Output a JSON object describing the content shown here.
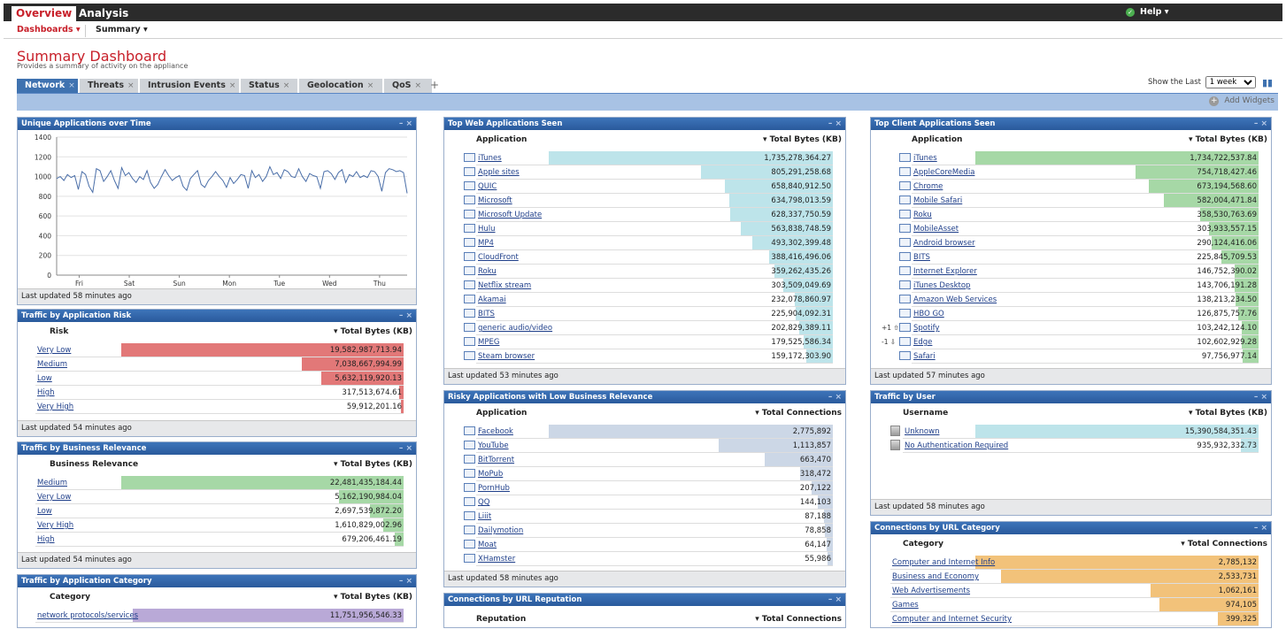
{
  "nav": {
    "overview": "Overview",
    "analysis": "Analysis",
    "help": "Help ▾",
    "help_icon": "check-circle-icon"
  },
  "subnav": {
    "dashboards": "Dashboards ▾",
    "summary": "Summary ▾"
  },
  "page": {
    "title": "Summary Dashboard",
    "subtitle": "Provides a summary of activity on the appliance"
  },
  "tabs": [
    "Network",
    "Threats",
    "Intrusion Events",
    "Status",
    "Geolocation",
    "QoS"
  ],
  "tab_add": "+",
  "tab_close": "×",
  "controls": {
    "show_last_label": "Show the Last",
    "show_last_value": "1 week",
    "pause_icon": "pause-icon"
  },
  "add_widgets": "Add Widgets",
  "colors": {
    "header_blue": "#3d74b9",
    "red": "#e27878",
    "green": "#a6d8a6",
    "cyan": "#bde4ea",
    "slate": "#ccd7e6",
    "purple": "#b9a9d7",
    "orange": "#f2c27a"
  },
  "w_unique": {
    "title": "Unique Applications over Time",
    "footer": "Last updated 58 minutes ago",
    "chart_data": {
      "type": "line",
      "title": "",
      "xlabel": "",
      "ylabel": "",
      "x_ticks": [
        "Fri",
        "Sat",
        "Sun",
        "Mon",
        "Tue",
        "Wed",
        "Thu"
      ],
      "y_ticks": [
        0,
        200,
        400,
        600,
        800,
        1000,
        1200,
        1400
      ],
      "ylim": [
        0,
        1400
      ],
      "grid": true,
      "series": [
        {
          "values": [
            980,
            1000,
            960,
            1020,
            990,
            1010,
            870,
            1050,
            1020,
            900,
            840,
            1080,
            1060,
            950,
            1000,
            1060,
            960,
            880,
            1090,
            1010,
            1040,
            980,
            940,
            1000,
            970,
            1060,
            940,
            880,
            920,
            1000,
            1070,
            1010,
            960,
            990,
            1010,
            900,
            860,
            980,
            1020,
            1060,
            920,
            890,
            960,
            1000,
            1050,
            1000,
            960,
            890,
            990,
            930,
            970,
            1020,
            1010,
            880,
            1060,
            990,
            1020,
            950,
            1000,
            1100,
            1020,
            1040,
            980,
            1070,
            1050,
            1000,
            990,
            1080,
            1000,
            950,
            1030,
            1010,
            1000,
            880,
            1050,
            1060,
            1030,
            970,
            1040,
            1070,
            940,
            1020,
            1000,
            1050,
            990,
            1010,
            990,
            1060,
            1050,
            1000,
            850,
            1040,
            1080,
            1070,
            1050,
            1060,
            1040,
            830
          ]
        }
      ]
    }
  },
  "w_risk": {
    "title": "Traffic by Application Risk",
    "col1": "Risk",
    "col2": "▾ Total Bytes (KB)",
    "rows": [
      {
        "name": "Very Low",
        "value": "19,582,987,713.94",
        "frac": 1.0
      },
      {
        "name": "Medium",
        "value": "7,038,667,994.99",
        "frac": 0.36
      },
      {
        "name": "Low",
        "value": "5,632,119,920.13",
        "frac": 0.29
      },
      {
        "name": "High",
        "value": "317,513,674.61",
        "frac": 0.016
      },
      {
        "name": "Very High",
        "value": "59,912,201.16",
        "frac": 0.003
      }
    ],
    "footer": "Last updated 54 minutes ago"
  },
  "w_business": {
    "title": "Traffic by Business Relevance",
    "col1": "Business Relevance",
    "col2": "▾ Total Bytes (KB)",
    "rows": [
      {
        "name": "Medium",
        "value": "22,481,435,184.44",
        "frac": 1.0
      },
      {
        "name": "Very Low",
        "value": "5,162,190,984.04",
        "frac": 0.23
      },
      {
        "name": "Low",
        "value": "2,697,539,872.20",
        "frac": 0.12
      },
      {
        "name": "Very High",
        "value": "1,610,829,002.96",
        "frac": 0.072
      },
      {
        "name": "High",
        "value": "679,206,461.19",
        "frac": 0.03
      }
    ],
    "footer": "Last updated 54 minutes ago"
  },
  "w_category": {
    "title": "Traffic by Application Category",
    "col1": "Category",
    "col2": "▾ Total Bytes (KB)",
    "rows": [
      {
        "name": "network protocols/services",
        "value": "11,751,956,546.33",
        "frac": 1.0
      }
    ]
  },
  "w_web": {
    "title": "Top Web Applications Seen",
    "col1": "Application",
    "col2": "▾ Total Bytes (KB)",
    "rows": [
      {
        "name": "iTunes",
        "value": "1,735,278,364.27",
        "frac": 1.0
      },
      {
        "name": "Apple sites",
        "value": "805,291,258.68",
        "frac": 0.464
      },
      {
        "name": "QUIC",
        "value": "658,840,912.50",
        "frac": 0.38
      },
      {
        "name": "Microsoft",
        "value": "634,798,013.59",
        "frac": 0.366
      },
      {
        "name": "Microsoft Update",
        "value": "628,337,750.59",
        "frac": 0.362
      },
      {
        "name": "Hulu",
        "value": "563,838,748.59",
        "frac": 0.325
      },
      {
        "name": "MP4",
        "value": "493,302,399.48",
        "frac": 0.284
      },
      {
        "name": "CloudFront",
        "value": "388,416,496.06",
        "frac": 0.224
      },
      {
        "name": "Roku",
        "value": "359,262,435.26",
        "frac": 0.207
      },
      {
        "name": "Netflix stream",
        "value": "303,509,049.69",
        "frac": 0.175
      },
      {
        "name": "Akamai",
        "value": "232,078,860.97",
        "frac": 0.134
      },
      {
        "name": "BITS",
        "value": "225,904,092.31",
        "frac": 0.13
      },
      {
        "name": "generic audio/video",
        "value": "202,829,389.11",
        "frac": 0.117
      },
      {
        "name": "MPEG",
        "value": "179,525,586.34",
        "frac": 0.103
      },
      {
        "name": "Steam browser",
        "value": "159,172,303.90",
        "frac": 0.092
      }
    ],
    "footer": "Last updated 53 minutes ago"
  },
  "w_risky": {
    "title": "Risky Applications with Low Business Relevance",
    "col1": "Application",
    "col2": "▾ Total Connections",
    "rows": [
      {
        "name": "Facebook",
        "value": "2,775,892",
        "frac": 1.0
      },
      {
        "name": "YouTube",
        "value": "1,113,857",
        "frac": 0.401
      },
      {
        "name": "BitTorrent",
        "value": "663,470",
        "frac": 0.239
      },
      {
        "name": "MoPub",
        "value": "318,472",
        "frac": 0.115
      },
      {
        "name": "PornHub",
        "value": "207,122",
        "frac": 0.075
      },
      {
        "name": "QQ",
        "value": "144,103",
        "frac": 0.052
      },
      {
        "name": "Liiit",
        "value": "87,188",
        "frac": 0.031
      },
      {
        "name": "Dailymotion",
        "value": "78,858",
        "frac": 0.028
      },
      {
        "name": "Moat",
        "value": "64,147",
        "frac": 0.023
      },
      {
        "name": "XHamster",
        "value": "55,986",
        "frac": 0.02
      }
    ],
    "footer": "Last updated 58 minutes ago"
  },
  "w_reputation": {
    "title": "Connections by URL Reputation",
    "col1": "Reputation",
    "col2": "▾ Total Connections"
  },
  "w_client": {
    "title": "Top Client Applications Seen",
    "col1": "Application",
    "col2": "▾ Total Bytes (KB)",
    "rows": [
      {
        "name": "iTunes",
        "value": "1,734,722,537.84",
        "frac": 1.0
      },
      {
        "name": "AppleCoreMedia",
        "value": "754,718,427.46",
        "frac": 0.435
      },
      {
        "name": "Chrome",
        "value": "673,194,568.60",
        "frac": 0.388
      },
      {
        "name": "Mobile Safari",
        "value": "582,004,471.84",
        "frac": 0.335
      },
      {
        "name": "Roku",
        "value": "358,530,763.69",
        "frac": 0.207
      },
      {
        "name": "MobileAsset",
        "value": "303,933,557.15",
        "frac": 0.175
      },
      {
        "name": "Android browser",
        "value": "290,124,416.06",
        "frac": 0.167
      },
      {
        "name": "BITS",
        "value": "225,845,709.53",
        "frac": 0.13
      },
      {
        "name": "Internet Explorer",
        "value": "146,752,390.02",
        "frac": 0.085
      },
      {
        "name": "iTunes Desktop",
        "value": "143,706,191.28",
        "frac": 0.083
      },
      {
        "name": "Amazon Web Services",
        "value": "138,213,234.50",
        "frac": 0.08
      },
      {
        "name": "HBO GO",
        "value": "126,875,757.76",
        "frac": 0.073
      },
      {
        "name": "Spotify",
        "value": "103,242,124.10",
        "frac": 0.06,
        "delta": "+1 ⇧"
      },
      {
        "name": "Edge",
        "value": "102,602,929.28",
        "frac": 0.059,
        "delta": "-1 ⇩"
      },
      {
        "name": "Safari",
        "value": "97,756,977.14",
        "frac": 0.056
      }
    ],
    "footer": "Last updated 57 minutes ago"
  },
  "w_user": {
    "title": "Traffic by User",
    "col1": "Username",
    "col2": "▾ Total Bytes (KB)",
    "rows": [
      {
        "name": "Unknown",
        "value": "15,390,584,351.43",
        "frac": 1.0
      },
      {
        "name": "No Authentication Required",
        "value": "935,932,332.73",
        "frac": 0.061
      }
    ],
    "footer": "Last updated 58 minutes ago"
  },
  "w_urlcat": {
    "title": "Connections by URL Category",
    "col1": "Category",
    "col2": "▾ Total Connections",
    "rows": [
      {
        "name": "Computer and Internet Info",
        "value": "2,785,132",
        "frac": 1.0
      },
      {
        "name": "Business and Economy",
        "value": "2,533,731",
        "frac": 0.91
      },
      {
        "name": "Web Advertisements",
        "value": "1,062,161",
        "frac": 0.381
      },
      {
        "name": "Games",
        "value": "974,105",
        "frac": 0.35
      },
      {
        "name": "Computer and Internet Security",
        "value": "399,325",
        "frac": 0.143
      }
    ]
  },
  "widget_ctl": "– ×"
}
